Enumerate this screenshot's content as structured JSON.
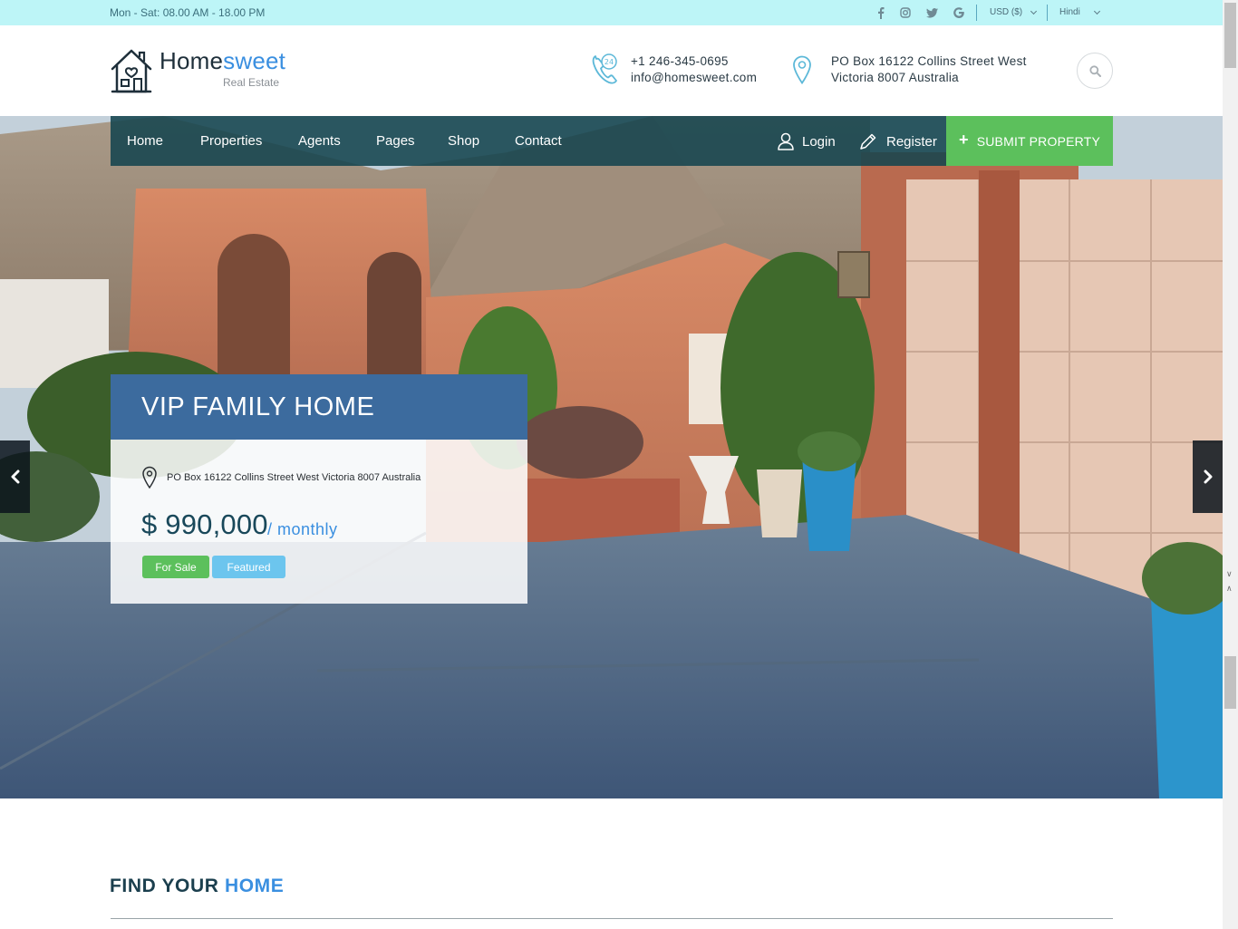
{
  "topbar": {
    "hours": "Mon - Sat: 08.00 AM - 18.00 PM",
    "social": [
      "facebook-icon",
      "instagram-icon",
      "twitter-icon",
      "google-icon"
    ],
    "currency": "USD ($)",
    "language": "Hindi"
  },
  "header": {
    "logo_main": "Home",
    "logo_accent": "sweet",
    "logo_sub": "Real Estate",
    "phone": "+1 246-345-0695",
    "email": "info@homesweet.com",
    "address_line1": "PO Box 16122 Collins Street West",
    "address_line2": "Victoria 8007 Australia"
  },
  "nav": {
    "items": [
      "Home",
      "Properties",
      "Agents",
      "Pages",
      "Shop",
      "Contact"
    ],
    "login": "Login",
    "register": "Register",
    "submit": "SUBMIT PROPERTY"
  },
  "slide": {
    "title": "VIP FAMILY HOME",
    "address": "PO Box 16122 Collins Street West Victoria 8007 Australia",
    "price": "$ 990,000",
    "period": "/ monthly",
    "badge_sale": "For Sale",
    "badge_featured": "Featured"
  },
  "section": {
    "title_main": "FIND YOUR ",
    "title_accent": "HOME"
  },
  "colors": {
    "topbar": "#bdf5f7",
    "nav": "#14444e",
    "accent_blue": "#3a8fe0",
    "green": "#5cc05c",
    "card_header": "#3c6b9e",
    "badge_featured": "#6cc5ee"
  }
}
